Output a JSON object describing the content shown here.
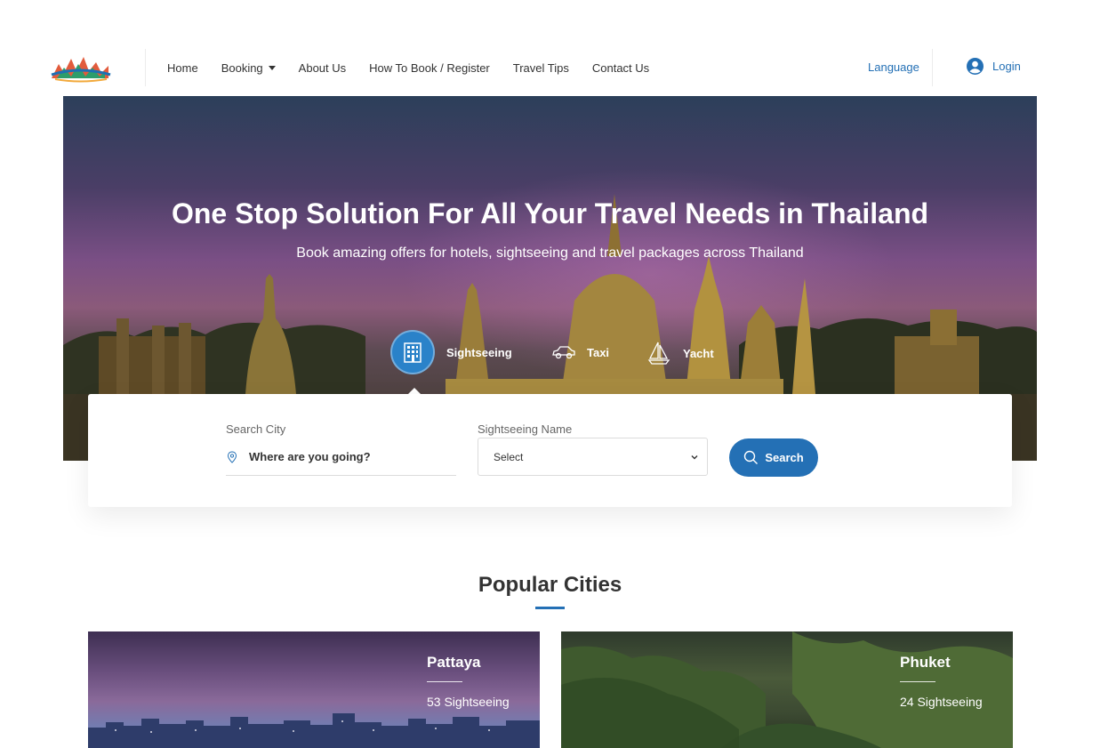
{
  "header": {
    "nav": [
      {
        "label": "Home"
      },
      {
        "label": "Booking",
        "has_dropdown": true
      },
      {
        "label": "About Us"
      },
      {
        "label": "How To Book / Register"
      },
      {
        "label": "Travel Tips"
      },
      {
        "label": "Contact Us"
      }
    ],
    "language_label": "Language",
    "login_label": "Login"
  },
  "hero": {
    "title": "One Stop Solution For All Your Travel Needs in Thailand",
    "subtitle": "Book amazing offers for hotels, sightseeing and travel packages across Thailand",
    "tabs": [
      {
        "label": "Sightseeing",
        "icon": "building-icon",
        "active": true
      },
      {
        "label": "Taxi",
        "icon": "car-icon",
        "active": false
      },
      {
        "label": "Yacht",
        "icon": "sailboat-icon",
        "active": false
      }
    ]
  },
  "search": {
    "city_label": "Search City",
    "city_placeholder": "Where are you going?",
    "sightseeing_label": "Sightseeing Name",
    "sightseeing_selected": "Select",
    "button_label": "Search"
  },
  "popular": {
    "title": "Popular Cities",
    "cities": [
      {
        "name": "Pattaya",
        "count": "53 Sightseeing"
      },
      {
        "name": "Phuket",
        "count": "24 Sightseeing"
      }
    ]
  },
  "colors": {
    "accent": "#2470b5",
    "tab_active": "#2a82c9"
  }
}
